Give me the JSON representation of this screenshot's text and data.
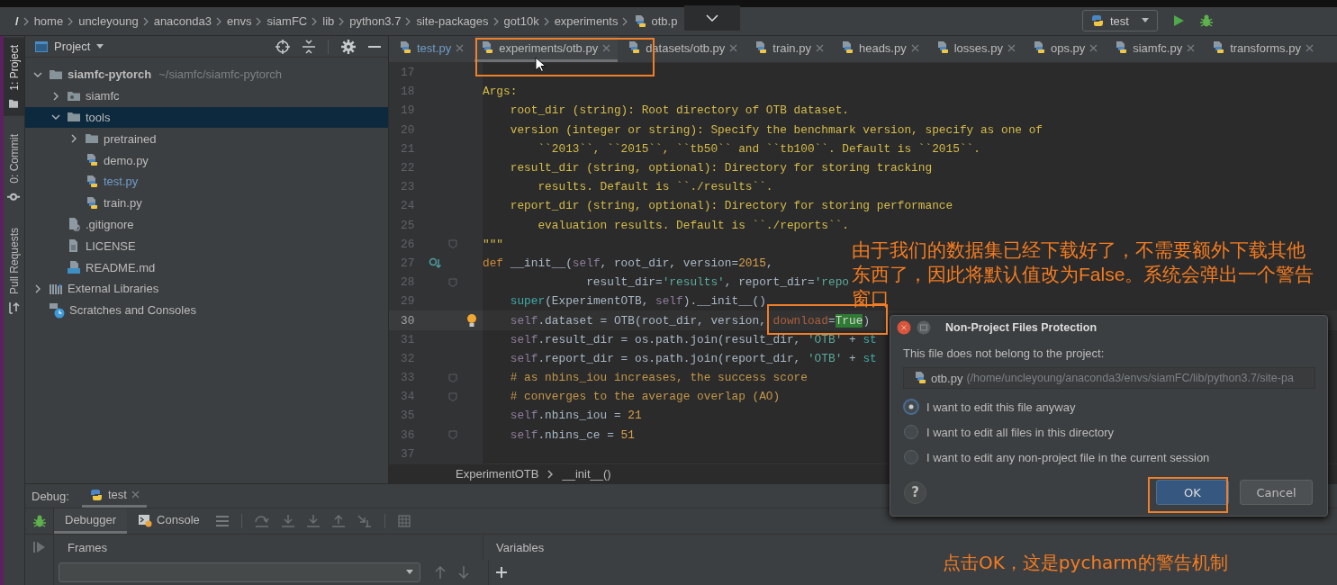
{
  "navigation_bar": {
    "path": [
      {
        "label": "/",
        "kind": "root"
      },
      {
        "label": "home",
        "kind": "folder"
      },
      {
        "label": "uncleyoung",
        "kind": "folder"
      },
      {
        "label": "anaconda3",
        "kind": "folder"
      },
      {
        "label": "envs",
        "kind": "folder"
      },
      {
        "label": "siamFC",
        "kind": "folder"
      },
      {
        "label": "lib",
        "kind": "folder"
      },
      {
        "label": "python3.7",
        "kind": "folder"
      },
      {
        "label": "site-packages",
        "kind": "folder"
      },
      {
        "label": "got10k",
        "kind": "folder"
      },
      {
        "label": "experiments",
        "kind": "folder"
      },
      {
        "label": "otb.p",
        "kind": "python"
      }
    ],
    "run_configuration": "test"
  },
  "tool_strip": [
    {
      "label": "1: Project",
      "kind": "project",
      "selected": true
    },
    {
      "label": "0: Commit",
      "kind": "commit",
      "selected": false
    },
    {
      "label": "Pull Requests",
      "kind": "pull_requests",
      "selected": false
    }
  ],
  "project_panel": {
    "title": "Project",
    "tree": [
      {
        "label": "siamfc-pytorch",
        "kind": "project",
        "hint": "~/siamfc/siamfc-pytorch",
        "expanded": true,
        "selected": false,
        "changed": false,
        "children": [
          {
            "label": "siamfc",
            "kind": "package",
            "expanded": false,
            "selected": false,
            "changed": false
          },
          {
            "label": "tools",
            "kind": "folder",
            "expanded": true,
            "selected": true,
            "changed": false,
            "children": [
              {
                "label": "pretrained",
                "kind": "folder",
                "expanded": false,
                "selected": false,
                "changed": false
              },
              {
                "label": "demo.py",
                "kind": "python",
                "selected": false,
                "changed": false
              },
              {
                "label": "test.py",
                "kind": "python",
                "selected": false,
                "changed": true
              },
              {
                "label": "train.py",
                "kind": "python",
                "selected": false,
                "changed": false
              }
            ]
          },
          {
            "label": ".gitignore",
            "kind": "ignore",
            "selected": false,
            "changed": false
          },
          {
            "label": "LICENSE",
            "kind": "text",
            "selected": false,
            "changed": false
          },
          {
            "label": "README.md",
            "kind": "markdown",
            "selected": false,
            "changed": false
          }
        ]
      },
      {
        "label": "External Libraries",
        "kind": "libraries",
        "expanded": false,
        "selected": false,
        "changed": false
      },
      {
        "label": "Scratches and Consoles",
        "kind": "scratches",
        "selected": false,
        "changed": false
      }
    ]
  },
  "editor": {
    "tabs": [
      {
        "label": "test.py",
        "selected": false,
        "changed": true
      },
      {
        "label": "experiments/otb.py",
        "selected": true,
        "changed": false
      },
      {
        "label": "datasets/otb.py",
        "selected": false,
        "changed": false
      },
      {
        "label": "train.py",
        "selected": false,
        "changed": false
      },
      {
        "label": "heads.py",
        "selected": false,
        "changed": false
      },
      {
        "label": "losses.py",
        "selected": false,
        "changed": false
      },
      {
        "label": "ops.py",
        "selected": false,
        "changed": false
      },
      {
        "label": "siamfc.py",
        "selected": false,
        "changed": false
      },
      {
        "label": "transforms.py",
        "selected": false,
        "changed": false
      }
    ],
    "lines": [
      {
        "number": "17",
        "current": false,
        "fold": false,
        "override": false,
        "bulb": false
      },
      {
        "number": "18",
        "current": false,
        "fold": false,
        "override": false,
        "bulb": false,
        "tokens": [
          {
            "text": "Args:",
            "kind": "doc"
          }
        ]
      },
      {
        "number": "19",
        "current": false,
        "fold": false,
        "override": false,
        "bulb": false,
        "tokens": [
          {
            "text": "    root_dir (string): Root directory of OTB dataset.",
            "kind": "doc"
          }
        ]
      },
      {
        "number": "20",
        "current": false,
        "fold": false,
        "override": false,
        "bulb": false,
        "tokens": [
          {
            "text": "    version (integer or string): Specify the benchmark version, specify as one of",
            "kind": "doc"
          }
        ]
      },
      {
        "number": "21",
        "current": false,
        "fold": false,
        "override": false,
        "bulb": false,
        "tokens": [
          {
            "text": "        ``2013``, ``2015``, ``tb50`` and ``tb100``. Default is ``2015``.",
            "kind": "doc"
          }
        ]
      },
      {
        "number": "22",
        "current": false,
        "fold": false,
        "override": false,
        "bulb": false,
        "tokens": [
          {
            "text": "    result_dir (string, optional): Directory for storing tracking",
            "kind": "doc"
          }
        ]
      },
      {
        "number": "23",
        "current": false,
        "fold": false,
        "override": false,
        "bulb": false,
        "tokens": [
          {
            "text": "        results. Default is ``./results``.",
            "kind": "doc"
          }
        ]
      },
      {
        "number": "24",
        "current": false,
        "fold": false,
        "override": false,
        "bulb": false,
        "tokens": [
          {
            "text": "    report_dir (string, optional): Directory for storing performance",
            "kind": "doc"
          }
        ]
      },
      {
        "number": "25",
        "current": false,
        "fold": false,
        "override": false,
        "bulb": false,
        "tokens": [
          {
            "text": "        evaluation results. Default is ``./reports``.",
            "kind": "doc"
          }
        ]
      },
      {
        "number": "26",
        "current": false,
        "fold": true,
        "override": false,
        "bulb": false,
        "tokens": [
          {
            "text": "\"\"\"",
            "kind": "doc"
          }
        ]
      },
      {
        "number": "27",
        "current": false,
        "fold": false,
        "override": true,
        "bulb": false,
        "tokens": [
          {
            "text": "def",
            "kind": "keyword"
          },
          {
            "text": " __init__(",
            "kind": "plain"
          },
          {
            "text": "self",
            "kind": "self"
          },
          {
            "text": ", root_dir, version=",
            "kind": "plain"
          },
          {
            "text": "2015",
            "kind": "number"
          },
          {
            "text": ",",
            "kind": "plain"
          }
        ]
      },
      {
        "number": "28",
        "current": false,
        "fold": true,
        "override": false,
        "bulb": false,
        "tokens": [
          {
            "text": "               result_dir=",
            "kind": "plain"
          },
          {
            "text": "'results'",
            "kind": "string"
          },
          {
            "text": ", report_dir=",
            "kind": "plain"
          },
          {
            "text": "'repo",
            "kind": "string"
          }
        ]
      },
      {
        "number": "29",
        "current": false,
        "fold": false,
        "override": false,
        "bulb": false,
        "tokens": [
          {
            "text": "    super",
            "kind": "builtin"
          },
          {
            "text": "(ExperimentOTB, ",
            "kind": "plain"
          },
          {
            "text": "self",
            "kind": "self"
          },
          {
            "text": ").__init__()",
            "kind": "plain"
          }
        ]
      },
      {
        "number": "30",
        "current": true,
        "fold": false,
        "override": false,
        "bulb": true,
        "tokens": [
          {
            "text": "    self",
            "kind": "self"
          },
          {
            "text": ".dataset = OTB(root_dir, version, ",
            "kind": "plain"
          },
          {
            "text": "download",
            "kind": "kwarg"
          },
          {
            "text": "=",
            "kind": "plain"
          },
          {
            "text": "True",
            "kind": "highlight"
          },
          {
            "text": ")",
            "kind": "plain"
          }
        ]
      },
      {
        "number": "31",
        "current": false,
        "fold": false,
        "override": false,
        "bulb": false,
        "tokens": [
          {
            "text": "    self",
            "kind": "self"
          },
          {
            "text": ".result_dir = os.path.join(result_dir, ",
            "kind": "plain"
          },
          {
            "text": "'OTB'",
            "kind": "string"
          },
          {
            "text": " + ",
            "kind": "plain"
          },
          {
            "text": "st",
            "kind": "builtin"
          }
        ]
      },
      {
        "number": "32",
        "current": false,
        "fold": false,
        "override": false,
        "bulb": false,
        "tokens": [
          {
            "text": "    self",
            "kind": "self"
          },
          {
            "text": ".report_dir = os.path.join(report_dir, ",
            "kind": "plain"
          },
          {
            "text": "'OTB'",
            "kind": "string"
          },
          {
            "text": " + ",
            "kind": "plain"
          },
          {
            "text": "st",
            "kind": "builtin"
          }
        ]
      },
      {
        "number": "33",
        "current": false,
        "fold": true,
        "override": false,
        "bulb": false,
        "tokens": [
          {
            "text": "    # as nbins_iou increases, the success score",
            "kind": "comment"
          }
        ]
      },
      {
        "number": "34",
        "current": false,
        "fold": true,
        "override": false,
        "bulb": false,
        "tokens": [
          {
            "text": "    # converges to the average overlap (AO)",
            "kind": "comment"
          }
        ]
      },
      {
        "number": "35",
        "current": false,
        "fold": false,
        "override": false,
        "bulb": false,
        "tokens": [
          {
            "text": "    self",
            "kind": "self"
          },
          {
            "text": ".nbins_iou = ",
            "kind": "plain"
          },
          {
            "text": "21",
            "kind": "number"
          }
        ]
      },
      {
        "number": "36",
        "current": false,
        "fold": true,
        "override": false,
        "bulb": false,
        "tokens": [
          {
            "text": "    self",
            "kind": "self"
          },
          {
            "text": ".nbins_ce = ",
            "kind": "plain"
          },
          {
            "text": "51",
            "kind": "number"
          }
        ]
      },
      {
        "number": "37",
        "current": false,
        "fold": false,
        "override": false,
        "bulb": false
      }
    ],
    "breadcrumb": [
      "ExperimentOTB",
      "__init__()"
    ]
  },
  "debug_panel": {
    "label": "Debug:",
    "tabs": [
      {
        "label": "test",
        "selected": true
      }
    ],
    "views": [
      {
        "label": "Debugger",
        "kind": "debugger",
        "selected": true
      },
      {
        "label": "Console",
        "kind": "console",
        "selected": false
      }
    ],
    "frames_title": "Frames",
    "variables_title": "Variables"
  },
  "dialog": {
    "title": "Non-Project Files Protection",
    "message": "This file does not belong to the project:",
    "file_name": "otb.py",
    "file_path": "(/home/uncleyoung/anaconda3/envs/siamFC/lib/python3.7/site-pa",
    "options": [
      {
        "label": "I want to edit this file anyway",
        "selected": true
      },
      {
        "label": "I want to edit all files in this directory",
        "selected": false
      },
      {
        "label": "I want to edit any non-project file in the current session",
        "selected": false
      }
    ],
    "help": "?",
    "buttons": [
      {
        "label": "OK",
        "kind": "primary"
      },
      {
        "label": "Cancel",
        "kind": "secondary"
      }
    ]
  },
  "annotations": [
    {
      "kind": "note",
      "text": "由于我们的数据集已经下载好了，不需要额外下载其他东西了，因此将默认值改为False。系统会弹出一个警告窗口"
    },
    {
      "kind": "caption",
      "text": "点击OK，这是pycharm的警告机制"
    }
  ]
}
